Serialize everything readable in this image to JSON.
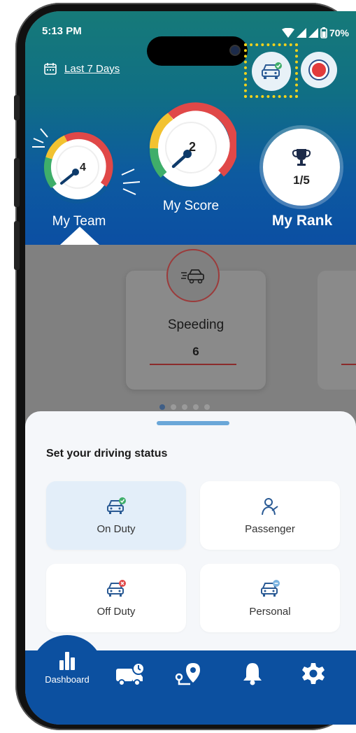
{
  "status_bar": {
    "time": "5:13 PM",
    "battery": "70%"
  },
  "header": {
    "date_filter_label": "Last 7 Days",
    "my_team": {
      "label": "My Team",
      "score": "4"
    },
    "my_score": {
      "label": "My Score",
      "score": "2"
    },
    "my_rank": {
      "label": "My Rank",
      "value": "1/5"
    }
  },
  "events": {
    "cards": [
      {
        "name": "Speeding",
        "count": "6"
      }
    ],
    "page_count": 5,
    "active_page": 1
  },
  "driving_status": {
    "title": "Set your driving status",
    "options": [
      {
        "label": "On Duty",
        "selected": true
      },
      {
        "label": "Passenger",
        "selected": false
      },
      {
        "label": "Off Duty",
        "selected": false
      },
      {
        "label": "Personal",
        "selected": false
      }
    ]
  },
  "nav": {
    "items": [
      {
        "label": "Dashboard",
        "active": true
      }
    ]
  },
  "colors": {
    "header_top": "#167a79",
    "header_bottom": "#0c4fa3",
    "nav_bg": "#0c50a0",
    "accent_red": "#e23b3b",
    "gauge_green": "#3fae6a",
    "gauge_yellow": "#f2c230",
    "gauge_red": "#e04848"
  }
}
